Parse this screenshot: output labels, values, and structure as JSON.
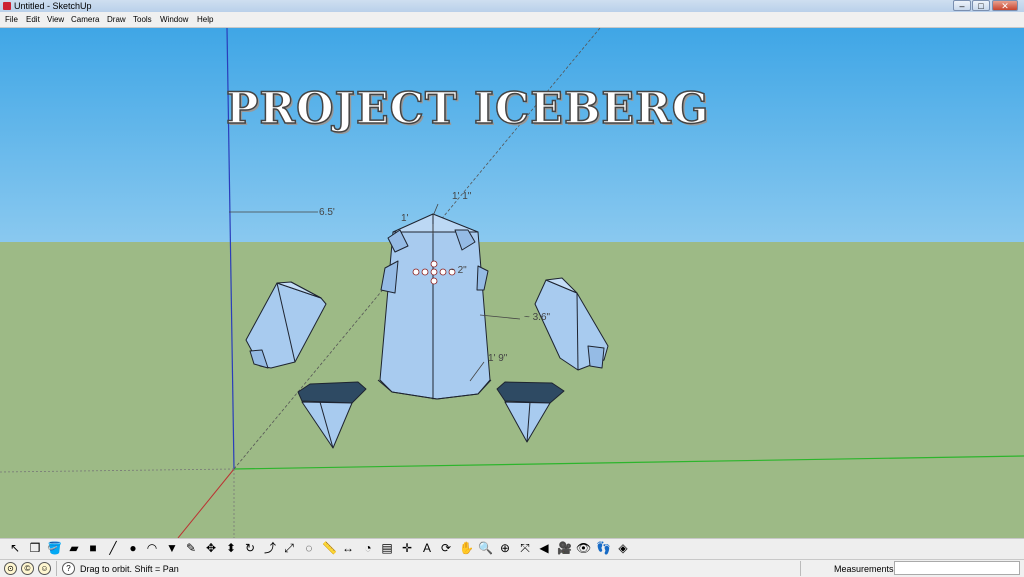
{
  "window": {
    "title": "Untitled - SketchUp",
    "minimize": "–",
    "maximize": "□",
    "close": "✕"
  },
  "menu": [
    "File",
    "Edit",
    "View",
    "Camera",
    "Draw",
    "Tools",
    "Window",
    "Help"
  ],
  "viewport": {
    "watermark": "PROJECT ICEBERG",
    "dimensions": {
      "guide_distance": "6.5'",
      "top_height": "1' 1\"",
      "side_width": "1'",
      "face_offset": "~ 2\"",
      "body_depth": "~ 3.6\"",
      "body_height": "1' 9\""
    },
    "colors": {
      "sky_top": "#3fa6e6",
      "sky_bottom": "#cfeaf8",
      "ground": "#9dba86",
      "model_face": "#a8cbef",
      "model_edge": "#1e2430",
      "axis_blue": "#2a3dbb",
      "axis_green": "#2cb52c",
      "axis_red": "#b33"
    }
  },
  "toolbar": {
    "tools": [
      {
        "name": "select-icon",
        "glyph": "↖"
      },
      {
        "name": "make-component-icon",
        "glyph": "❒"
      },
      {
        "name": "paint-bucket-icon",
        "glyph": "🪣"
      },
      {
        "name": "eraser-icon",
        "glyph": "▰"
      },
      {
        "name": "rectangle-icon",
        "glyph": "■"
      },
      {
        "name": "line-icon",
        "glyph": "╱"
      },
      {
        "name": "circle-icon",
        "glyph": "●"
      },
      {
        "name": "arc-icon",
        "glyph": "◠"
      },
      {
        "name": "polygon-icon",
        "glyph": "▼"
      },
      {
        "name": "freehand-icon",
        "glyph": "✎"
      },
      {
        "name": "move-icon",
        "glyph": "✥"
      },
      {
        "name": "push-pull-icon",
        "glyph": "⬍"
      },
      {
        "name": "rotate-icon",
        "glyph": "↻"
      },
      {
        "name": "follow-me-icon",
        "glyph": "⤴"
      },
      {
        "name": "scale-icon",
        "glyph": "⤢"
      },
      {
        "name": "offset-icon",
        "glyph": "◌"
      },
      {
        "name": "tape-measure-icon",
        "glyph": "📏"
      },
      {
        "name": "dimension-icon",
        "glyph": "↔"
      },
      {
        "name": "protractor-icon",
        "glyph": "◔"
      },
      {
        "name": "text-icon",
        "glyph": "▤"
      },
      {
        "name": "axes-icon",
        "glyph": "✛"
      },
      {
        "name": "3d-text-icon",
        "glyph": "A"
      },
      {
        "name": "orbit-icon",
        "glyph": "⟳"
      },
      {
        "name": "pan-icon",
        "glyph": "✋"
      },
      {
        "name": "zoom-icon",
        "glyph": "🔍"
      },
      {
        "name": "zoom-window-icon",
        "glyph": "⊕"
      },
      {
        "name": "zoom-extents-icon",
        "glyph": "⤧"
      },
      {
        "name": "previous-view-icon",
        "glyph": "◀"
      },
      {
        "name": "position-camera-icon",
        "glyph": "🎥"
      },
      {
        "name": "look-around-icon",
        "glyph": "👁"
      },
      {
        "name": "walk-icon",
        "glyph": "👣"
      },
      {
        "name": "section-plane-icon",
        "glyph": "◈"
      }
    ]
  },
  "status": {
    "hint": "Drag to orbit.  Shift = Pan",
    "measurements_label": "Measurements",
    "icons": [
      "geo-location-icon",
      "credits-icon",
      "user-icon",
      "help-icon"
    ]
  }
}
